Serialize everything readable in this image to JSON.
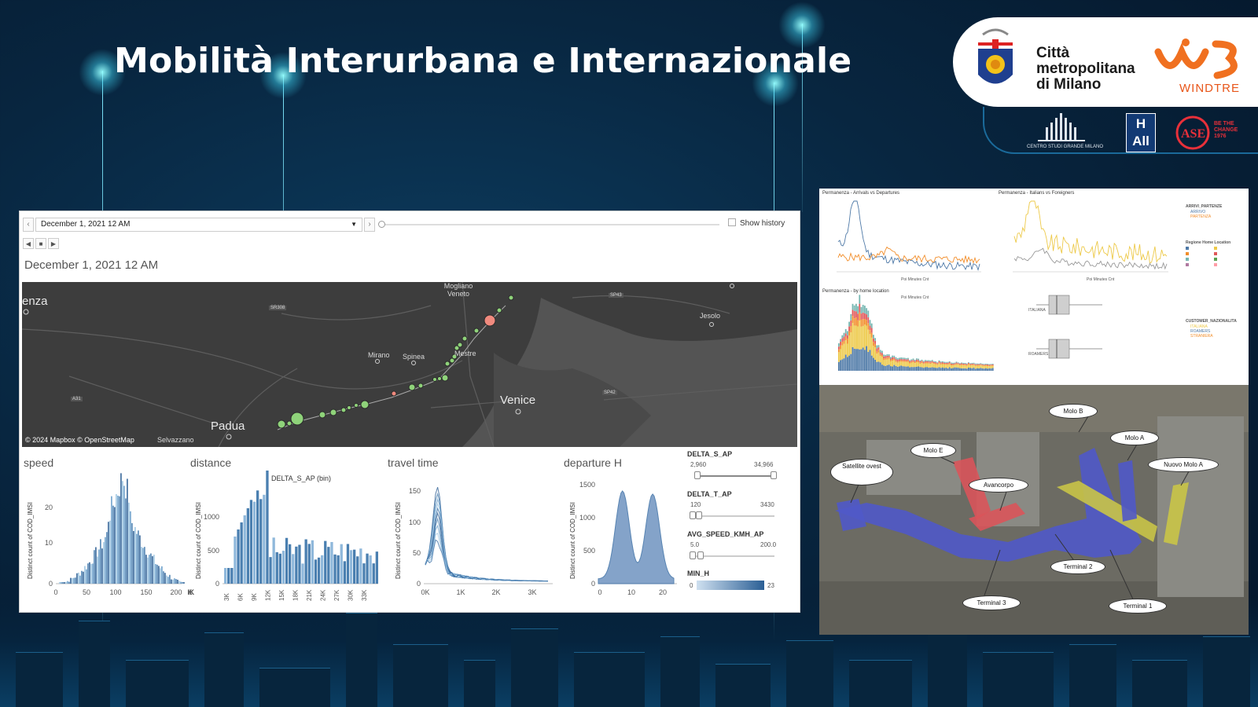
{
  "slide": {
    "title": "Mobilità Interurbana e Internazionale"
  },
  "logos": {
    "cmm_line1": "Città",
    "cmm_line2": "metropolitana",
    "cmm_line3": "di Milano",
    "windtre": "WINDTRE",
    "centro_studi": "CENTRO STUDI GRANDE MILANO",
    "hall": "H All",
    "ase_tagline": "BE THE CHANGE 1976"
  },
  "dashboard": {
    "date_value": "December 1, 2021 12 AM",
    "show_history_label": "Show history",
    "date_title": "December 1, 2021 12 AM",
    "map": {
      "credit": "© 2024 Mapbox  © OpenStreetMap",
      "places": [
        "enza",
        "Mogliano Veneto",
        "Mirano",
        "Spinea",
        "Mestre",
        "Jesolo",
        "Venice",
        "Padua",
        "Selvazzano"
      ],
      "roads": [
        "SR308",
        "A31",
        "SP42",
        "SP43"
      ]
    },
    "speed": {
      "title": "speed",
      "ylabel": "Distinct count of COD_IMSI",
      "yticks": [
        "20",
        "10",
        "0"
      ],
      "xticks": [
        "0",
        "50",
        "100",
        "150",
        "200"
      ]
    },
    "distance": {
      "title": "distance",
      "bin_label": "DELTA_S_AP (bin)",
      "ylabel": "Distinct count of COD_IMSI",
      "yticks": [
        "1000",
        "500",
        "0"
      ],
      "xticks": [
        "3K",
        "6K",
        "9K",
        "12K",
        "15K",
        "18K",
        "21K",
        "24K",
        "27K",
        "30K",
        "33K"
      ]
    },
    "travel_time": {
      "title": "travel time",
      "ylabel": "Distinct count of COD_IMSI",
      "yticks": [
        "150",
        "100",
        "50",
        "0"
      ],
      "xticks": [
        "0K",
        "1K",
        "2K",
        "3K"
      ]
    },
    "departure": {
      "title": "departure H",
      "ylabel": "Distinct count of COD_IMSI",
      "yticks": [
        "1500",
        "1000",
        "500",
        "0"
      ],
      "xticks": [
        "0",
        "10",
        "20"
      ]
    },
    "filters": {
      "delta_s": {
        "label": "DELTA_S_AP",
        "min": "2,960",
        "max": "34,966"
      },
      "delta_t": {
        "label": "DELTA_T_AP",
        "min": "120",
        "max": "3430"
      },
      "avg_speed": {
        "label": "AVG_SPEED_KMH_AP",
        "min": "5.0",
        "max": "200.0"
      },
      "min_h": {
        "label": "MIN_H",
        "min": "0",
        "max": "23"
      }
    }
  },
  "right_top": {
    "chart1_title": "Permanenza - Arrivals vs Departures",
    "chart2_title": "Permanenza - Italians vs Foreigners",
    "chart3_title": "Permanenza - by home location",
    "xlabel": "Poi Minutes Cnt",
    "legend1_title": "ARRIVI_PARTENZE",
    "legend1_items": [
      "ARRIVO",
      "PARTENZA"
    ],
    "legend2_title": "Regione Home Location",
    "legend3_title": "CUSTOMER_NAZIONALITA",
    "legend3_items": [
      "ITALIANA",
      "ROAMERS",
      "STRANIERA"
    ],
    "box_labels": [
      "ITALIANA",
      "ROAMERS"
    ]
  },
  "airport": {
    "labels": [
      "Molo B",
      "Molo A",
      "Molo E",
      "Satellite ovest",
      "Avancorpo",
      "Nuovo Molo A",
      "Terminal 2",
      "Terminal 3",
      "Terminal 1"
    ]
  },
  "colors": {
    "bar_blue": "#4e79a7",
    "orange": "#f28e2b",
    "yellow": "#edc948",
    "map_dot": "#8fd37a",
    "map_red": "#f08a7e"
  }
}
